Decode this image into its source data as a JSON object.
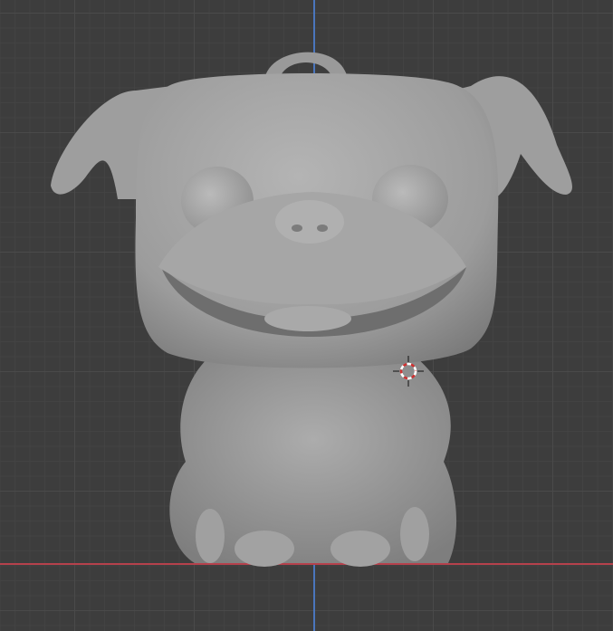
{
  "viewport": {
    "background_color": "#3d3d3d",
    "axis_x_color": "#b5414c",
    "axis_z_color": "#4a76bd",
    "model_color": "#9a9a9a"
  },
  "icons": {
    "cursor": "3d-cursor-icon"
  }
}
